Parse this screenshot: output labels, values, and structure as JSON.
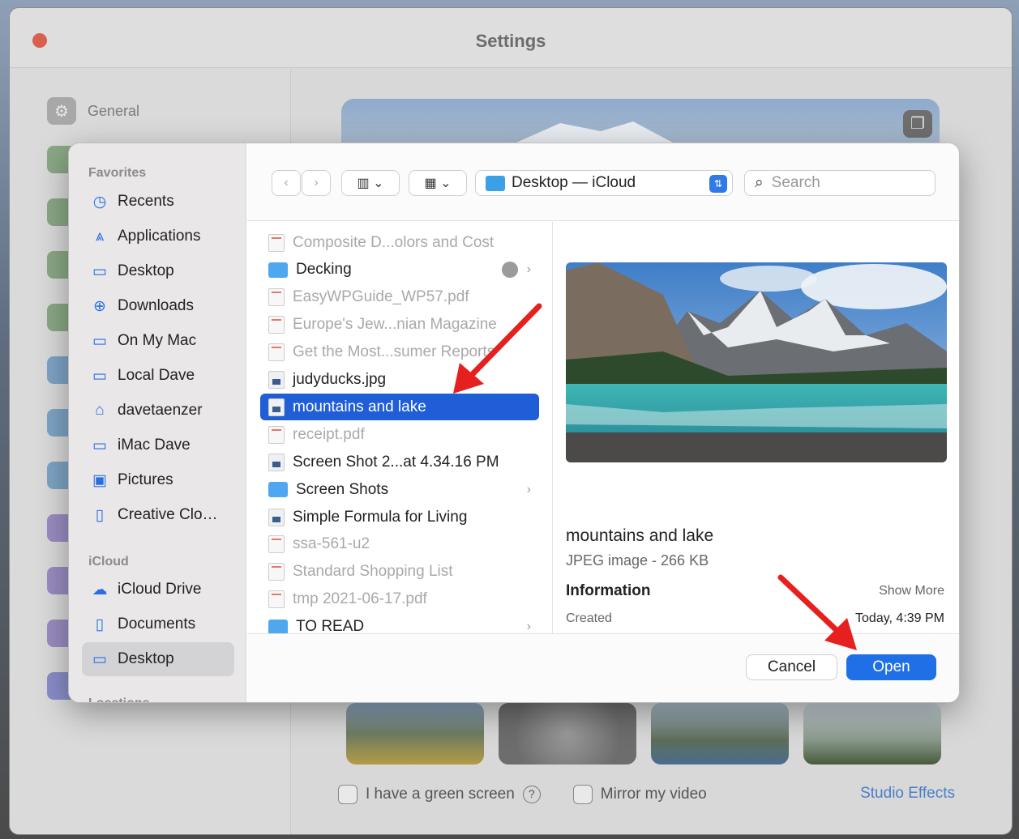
{
  "window": {
    "title": "Settings"
  },
  "settings_sidebar": {
    "first_item": "General"
  },
  "settings_bottom": {
    "green_screen": "I have a green screen",
    "help": "?",
    "mirror": "Mirror my video",
    "studio": "Studio Effects"
  },
  "dialog": {
    "location": "Desktop — iCloud",
    "search_placeholder": "Search",
    "sidebar": {
      "favorites_label": "Favorites",
      "favorites": [
        {
          "label": "Recents",
          "icon": "clock-icon"
        },
        {
          "label": "Applications",
          "icon": "applications-icon"
        },
        {
          "label": "Desktop",
          "icon": "desktop-icon"
        },
        {
          "label": "Downloads",
          "icon": "download-icon"
        },
        {
          "label": "On My Mac",
          "icon": "folder-icon"
        },
        {
          "label": "Local Dave",
          "icon": "folder-icon"
        },
        {
          "label": "davetaenzer",
          "icon": "home-icon"
        },
        {
          "label": "iMac Dave",
          "icon": "folder-icon"
        },
        {
          "label": "Pictures",
          "icon": "pictures-icon"
        },
        {
          "label": "Creative Clo…",
          "icon": "document-icon"
        }
      ],
      "icloud_label": "iCloud",
      "icloud": [
        {
          "label": "iCloud Drive",
          "icon": "cloud-icon"
        },
        {
          "label": "Documents",
          "icon": "document-icon"
        },
        {
          "label": "Desktop",
          "icon": "desktop-icon"
        }
      ],
      "locations_label": "Locations"
    },
    "files": [
      {
        "name": "Composite D...olors and Cost",
        "kind": "pdf",
        "dim": true
      },
      {
        "name": "Decking",
        "kind": "folder",
        "dim": false
      },
      {
        "name": "EasyWPGuide_WP57.pdf",
        "kind": "pdf",
        "dim": true
      },
      {
        "name": "Europe's Jew...nian Magazine",
        "kind": "pdf",
        "dim": true
      },
      {
        "name": "Get the Most...sumer Reports",
        "kind": "pdf",
        "dim": true
      },
      {
        "name": "judyducks.jpg",
        "kind": "img",
        "dim": false
      },
      {
        "name": "mountains and lake",
        "kind": "img",
        "dim": false
      },
      {
        "name": "receipt.pdf",
        "kind": "pdf",
        "dim": true
      },
      {
        "name": "Screen Shot 2...at 4.34.16 PM",
        "kind": "img",
        "dim": false
      },
      {
        "name": "Screen Shots",
        "kind": "folder",
        "dim": false
      },
      {
        "name": "Simple Formula for Living",
        "kind": "img",
        "dim": false
      },
      {
        "name": "ssa-561-u2",
        "kind": "pdf",
        "dim": true
      },
      {
        "name": "Standard Shopping List",
        "kind": "pdf",
        "dim": true
      },
      {
        "name": "tmp 2021-06-17.pdf",
        "kind": "pdf",
        "dim": true
      },
      {
        "name": "TO READ",
        "kind": "folder",
        "dim": false
      }
    ],
    "selected_file": "mountains and lake",
    "preview": {
      "name": "mountains and lake",
      "meta": "JPEG image - 266 KB",
      "info_label": "Information",
      "show_more": "Show More",
      "created_label": "Created",
      "created_value": "Today, 4:39 PM"
    },
    "cancel": "Cancel",
    "open": "Open"
  },
  "colors": {
    "accent": "#1f6fe6",
    "selection": "#1f5ed6",
    "arrow": "#e5201f"
  }
}
